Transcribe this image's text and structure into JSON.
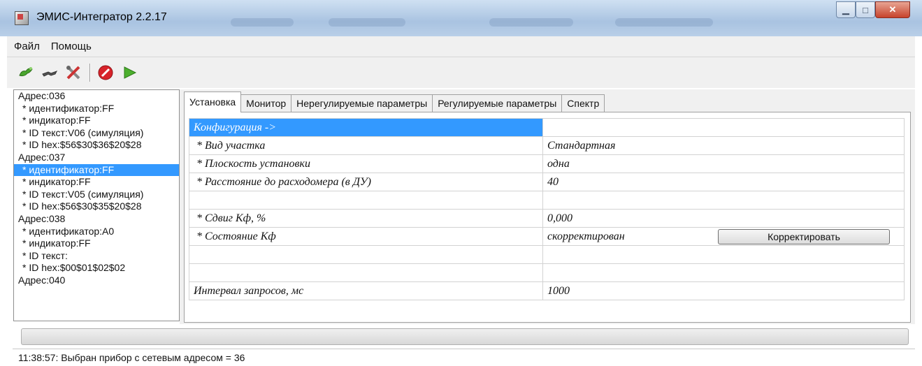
{
  "window": {
    "title": "ЭМИС-Интегратор 2.2.17"
  },
  "menu": [
    "Файл",
    "Помощь"
  ],
  "toolbar": {
    "buttons": [
      "connect-icon",
      "disconnect-icon",
      "settings-tools-icon",
      "stop-icon",
      "play-icon"
    ]
  },
  "tree": {
    "items": [
      {
        "label": "Адрес:036",
        "child": false,
        "selected": false
      },
      {
        "label": "* идентификатор:FF",
        "child": true,
        "selected": false
      },
      {
        "label": "* индикатор:FF",
        "child": true,
        "selected": false
      },
      {
        "label": "* ID текст:V06 (симуляция)",
        "child": true,
        "selected": false
      },
      {
        "label": "* ID hex:$56$30$36$20$28",
        "child": true,
        "selected": false
      },
      {
        "label": "Адрес:037",
        "child": false,
        "selected": false
      },
      {
        "label": "* идентификатор:FF",
        "child": true,
        "selected": true
      },
      {
        "label": "* индикатор:FF",
        "child": true,
        "selected": false
      },
      {
        "label": "* ID текст:V05 (симуляция)",
        "child": true,
        "selected": false
      },
      {
        "label": "* ID hex:$56$30$35$20$28",
        "child": true,
        "selected": false
      },
      {
        "label": "Адрес:038",
        "child": false,
        "selected": false
      },
      {
        "label": "* идентификатор:A0",
        "child": true,
        "selected": false
      },
      {
        "label": "* индикатор:FF",
        "child": true,
        "selected": false
      },
      {
        "label": "* ID текст:",
        "child": true,
        "selected": false
      },
      {
        "label": "* ID hex:$00$01$02$02",
        "child": true,
        "selected": false
      },
      {
        "label": "Адрес:040",
        "child": false,
        "selected": false
      }
    ]
  },
  "tabs": [
    {
      "label": "Установка",
      "active": true
    },
    {
      "label": "Монитор",
      "active": false
    },
    {
      "label": "Нерегулируемые параметры",
      "active": false
    },
    {
      "label": "Регулируемые параметры",
      "active": false
    },
    {
      "label": "Спектр",
      "active": false
    }
  ],
  "grid": {
    "rows": [
      {
        "name": "Конфигурация ->",
        "value": "",
        "header": true
      },
      {
        "name": "* Вид участка",
        "value": "Стандартная"
      },
      {
        "name": "* Плоскость установки",
        "value": "одна"
      },
      {
        "name": "* Расстояние до расходомера (в ДУ)",
        "value": "40"
      },
      {
        "name": "",
        "value": ""
      },
      {
        "name": "* Сдвиг Кф, %",
        "value": "0,000"
      },
      {
        "name": "* Состояние Кф",
        "value": "скорректирован",
        "button": "Корректировать"
      },
      {
        "name": "",
        "value": ""
      },
      {
        "name": "",
        "value": ""
      },
      {
        "name": "Интервал запросов, мс",
        "value": "1000",
        "plain": true
      }
    ]
  },
  "progress": {
    "value": 0
  },
  "status": {
    "text": "11:38:57: Выбран прибор с сетевым адресом = 36"
  },
  "colors": {
    "selection": "#3399ff",
    "titlebar": "#b9cfe8",
    "close": "#c7432c"
  }
}
